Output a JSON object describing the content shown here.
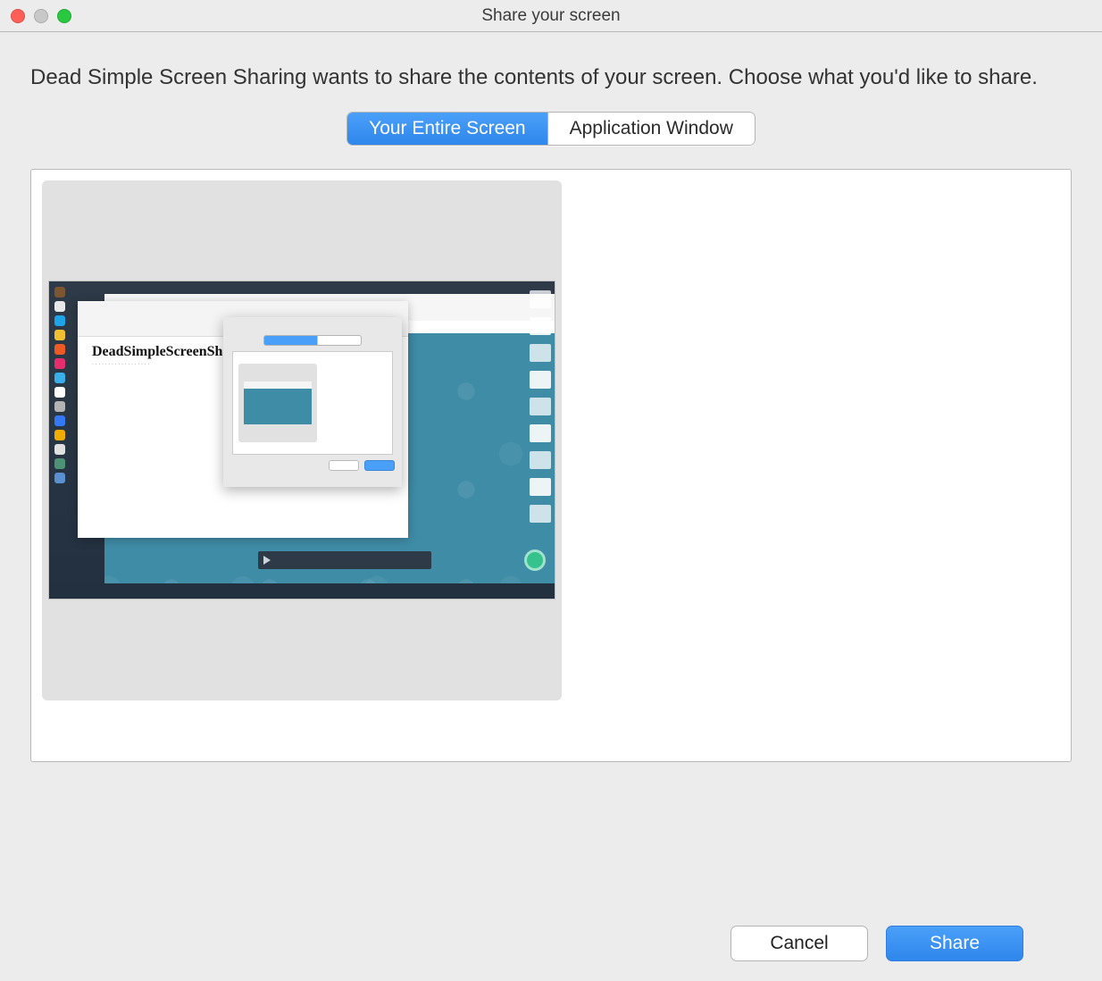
{
  "window": {
    "title": "Share your screen"
  },
  "prompt": "Dead Simple Screen Sharing wants to share the contents of your screen. Choose what you'd like to share.",
  "tabs": {
    "entire": "Your Entire Screen",
    "appwin": "Application Window",
    "active": "entire"
  },
  "preview": {
    "app_caption": "DeadSimpleScreenShari"
  },
  "buttons": {
    "cancel": "Cancel",
    "share": "Share"
  }
}
